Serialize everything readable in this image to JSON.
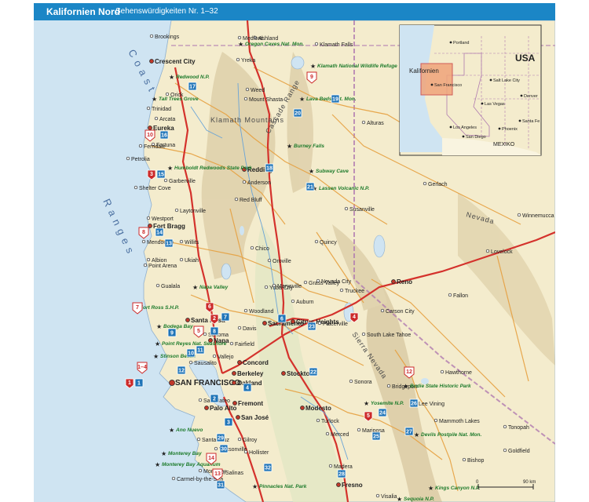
{
  "header": {
    "title": "Kalifornien Nord",
    "subtitle": "Sehenswürdigkeiten Nr. 1–32"
  },
  "colors": {
    "header_bar": "#1b86c6",
    "ocean": "#cfe4f2",
    "land": "#f4eccd",
    "highway": "#d4322c",
    "road": "#e6a040",
    "badge_blue": "#1f74b8",
    "pin_red": "#cc2a2a",
    "park_green": "#1c7a2a"
  },
  "cities": [
    {
      "id": "brookings",
      "label": "Brookings",
      "size": "small"
    },
    {
      "id": "crescent",
      "label": "Crescent City",
      "size": "medium"
    },
    {
      "id": "eureka",
      "label": "Eureka",
      "size": "medium"
    },
    {
      "id": "arcata",
      "label": "Arcata",
      "size": "small"
    },
    {
      "id": "fortuna",
      "label": "Fortuna",
      "size": "small"
    },
    {
      "id": "trinidad",
      "label": "Trinidad",
      "size": "small"
    },
    {
      "id": "orick",
      "label": "Orick",
      "size": "small"
    },
    {
      "id": "ferndale",
      "label": "Ferndale",
      "size": "small"
    },
    {
      "id": "petrolia",
      "label": "Petrolia",
      "size": "small"
    },
    {
      "id": "sheltercove",
      "label": "Shelter Cove",
      "size": "small"
    },
    {
      "id": "garberville",
      "label": "Garberville",
      "size": "small"
    },
    {
      "id": "westport",
      "label": "Westport",
      "size": "small"
    },
    {
      "id": "fortbragg",
      "label": "Fort Bragg",
      "size": "medium"
    },
    {
      "id": "mendocino",
      "label": "Mendocino",
      "size": "small"
    },
    {
      "id": "albion",
      "label": "Albion",
      "size": "small"
    },
    {
      "id": "pointarena",
      "label": "Point Arena",
      "size": "small"
    },
    {
      "id": "gualala",
      "label": "Gualala",
      "size": "small"
    },
    {
      "id": "ukiah",
      "label": "Ukiah",
      "size": "small"
    },
    {
      "id": "willits",
      "label": "Willits",
      "size": "small"
    },
    {
      "id": "laytonville",
      "label": "Laytonville",
      "size": "small"
    },
    {
      "id": "santarosa",
      "label": "Santa Rosa",
      "size": "medium"
    },
    {
      "id": "napa",
      "label": "Napa",
      "size": "medium"
    },
    {
      "id": "sonoma",
      "label": "Sonoma",
      "size": "small"
    },
    {
      "id": "fairfield",
      "label": "Fairfield",
      "size": "small"
    },
    {
      "id": "vallejo",
      "label": "Vallejo",
      "size": "small"
    },
    {
      "id": "sausalito",
      "label": "Sausalito",
      "size": "small"
    },
    {
      "id": "sf",
      "label": "SAN FRANCISCO",
      "size": "large"
    },
    {
      "id": "oakland",
      "label": "Oakland",
      "size": "medium"
    },
    {
      "id": "berkeley",
      "label": "Berkeley",
      "size": "medium"
    },
    {
      "id": "concord",
      "label": "Concord",
      "size": "medium"
    },
    {
      "id": "sanmateo",
      "label": "San Mateo",
      "size": "small"
    },
    {
      "id": "paloalto",
      "label": "Palo Alto",
      "size": "medium"
    },
    {
      "id": "fremont",
      "label": "Fremont",
      "size": "medium"
    },
    {
      "id": "sanjose",
      "label": "San José",
      "size": "medium"
    },
    {
      "id": "santacruz",
      "label": "Santa Cruz",
      "size": "small"
    },
    {
      "id": "monterey",
      "label": "Monterey",
      "size": "small"
    },
    {
      "id": "salinas",
      "label": "Salinas",
      "size": "small"
    },
    {
      "id": "carmel",
      "label": "Carmel-by-the-Sea",
      "size": "small"
    },
    {
      "id": "watsonville",
      "label": "Watsonville",
      "size": "small"
    },
    {
      "id": "gilroy",
      "label": "Gilroy",
      "size": "small"
    },
    {
      "id": "hollister",
      "label": "Hollister",
      "size": "small"
    },
    {
      "id": "stockton",
      "label": "Stockton",
      "size": "medium"
    },
    {
      "id": "modesto",
      "label": "Modesto",
      "size": "medium"
    },
    {
      "id": "merced",
      "label": "Merced",
      "size": "small"
    },
    {
      "id": "turlock",
      "label": "Turlock",
      "size": "small"
    },
    {
      "id": "fresno",
      "label": "Fresno",
      "size": "medium"
    },
    {
      "id": "madera",
      "label": "Madera",
      "size": "small"
    },
    {
      "id": "sacramento",
      "label": "Sacramento",
      "size": "medium"
    },
    {
      "id": "citrus",
      "label": "Citrus Heights",
      "size": "medium"
    },
    {
      "id": "davis",
      "label": "Davis",
      "size": "small"
    },
    {
      "id": "woodland",
      "label": "Woodland",
      "size": "small"
    },
    {
      "id": "yubacity",
      "label": "Yuba City",
      "size": "small"
    },
    {
      "id": "marysville",
      "label": "Marysville",
      "size": "small"
    },
    {
      "id": "oroville",
      "label": "Oroville",
      "size": "small"
    },
    {
      "id": "chico",
      "label": "Chico",
      "size": "small"
    },
    {
      "id": "redbluff",
      "label": "Red Bluff",
      "size": "small"
    },
    {
      "id": "redding",
      "label": "Redding",
      "size": "medium"
    },
    {
      "id": "anderson",
      "label": "Anderson",
      "size": "small"
    },
    {
      "id": "yreka",
      "label": "Yreka",
      "size": "small"
    },
    {
      "id": "weed",
      "label": "Weed",
      "size": "small"
    },
    {
      "id": "mtshasta",
      "label": "Mount Shasta",
      "size": "small"
    },
    {
      "id": "ashland",
      "label": "Ashland",
      "size": "small"
    },
    {
      "id": "medford",
      "label": "Medford",
      "size": "small"
    },
    {
      "id": "klamathfalls",
      "label": "Klamath Falls",
      "size": "small"
    },
    {
      "id": "alturas",
      "label": "Alturas",
      "size": "small"
    },
    {
      "id": "susanville",
      "label": "Susanville",
      "size": "small"
    },
    {
      "id": "quincy",
      "label": "Quincy",
      "size": "small"
    },
    {
      "id": "grassvalley",
      "label": "Grass Valley",
      "size": "small"
    },
    {
      "id": "nevadacity",
      "label": "Nevada City",
      "size": "small"
    },
    {
      "id": "truckee",
      "label": "Truckee",
      "size": "small"
    },
    {
      "id": "reno",
      "label": "Reno",
      "size": "medium"
    },
    {
      "id": "carsoncity",
      "label": "Carson City",
      "size": "small"
    },
    {
      "id": "southlaketahoe",
      "label": "South Lake Tahoe",
      "size": "small"
    },
    {
      "id": "placerville",
      "label": "Placerville",
      "size": "small"
    },
    {
      "id": "auburn",
      "label": "Auburn",
      "size": "small"
    },
    {
      "id": "sonora",
      "label": "Sonora",
      "size": "small"
    },
    {
      "id": "mariposa",
      "label": "Mariposa",
      "size": "small"
    },
    {
      "id": "bridgeport",
      "label": "Bridgeport",
      "size": "small"
    },
    {
      "id": "leevining",
      "label": "Lee Vining",
      "size": "small"
    },
    {
      "id": "mammoth",
      "label": "Mammoth Lakes",
      "size": "small"
    },
    {
      "id": "bishop",
      "label": "Bishop",
      "size": "small"
    },
    {
      "id": "hawthorne",
      "label": "Hawthorne",
      "size": "small"
    },
    {
      "id": "fallon",
      "label": "Fallon",
      "size": "small"
    },
    {
      "id": "lovelock",
      "label": "Lovelock",
      "size": "small"
    },
    {
      "id": "winnemucca",
      "label": "Winnemucca",
      "size": "small"
    },
    {
      "id": "gerlach",
      "label": "Gerlach",
      "size": "small"
    },
    {
      "id": "tonopah",
      "label": "Tonopah",
      "size": "small"
    },
    {
      "id": "goldfield",
      "label": "Goldfield",
      "size": "small"
    },
    {
      "id": "visalia",
      "label": "Visalia",
      "size": "small"
    }
  ],
  "parks": [
    {
      "id": "redwood",
      "label": "Redwood N.P."
    },
    {
      "id": "talltrees",
      "label": "Tall Trees Grove"
    },
    {
      "id": "humboldt",
      "label": "Humboldt Redwoods State Park"
    },
    {
      "id": "lassen",
      "label": "Lassen Volcanic N.P."
    },
    {
      "id": "lavabeds",
      "label": "Lava Beds Nat. Mon."
    },
    {
      "id": "oregoncaves",
      "label": "Oregon Caves Nat. Mon."
    },
    {
      "id": "klamathnwr",
      "label": "Klamath National Wildlife Refuge"
    },
    {
      "id": "burneyfalls",
      "label": "Burney Falls"
    },
    {
      "id": "subwaycave",
      "label": "Subway Cave"
    },
    {
      "id": "fortross",
      "label": "Fort Ross S.H.P."
    },
    {
      "id": "pointreyes",
      "label": "Point Reyes Nat. Seashore"
    },
    {
      "id": "yosemite",
      "label": "Yosemite N.P."
    },
    {
      "id": "bodie",
      "label": "Bodie State Historic Park"
    },
    {
      "id": "devils",
      "label": "Devils Postpile Nat. Mon."
    },
    {
      "id": "kingscanyon",
      "label": "Kings Canyon N.P."
    },
    {
      "id": "sequoia",
      "label": "Sequoia N.P."
    },
    {
      "id": "pinnacles",
      "label": "Pinnacles Nat. Park"
    },
    {
      "id": "anonuevo",
      "label": "Ano Nuevo"
    },
    {
      "id": "montereybay",
      "label": "Monterey Bay"
    },
    {
      "id": "montereyaquarium",
      "label": "Monterey Bay Aquarium"
    },
    {
      "id": "stinson",
      "label": "Stinson Beach"
    },
    {
      "id": "bodegabay",
      "label": "Bodega Bay"
    },
    {
      "id": "napavalley",
      "label": "Napa Valley"
    }
  ],
  "ranges": [
    {
      "id": "coastranges_a",
      "label": "Coast"
    },
    {
      "id": "coastranges_b",
      "label": "Ranges"
    },
    {
      "id": "cascade",
      "label": "Cascade Range"
    },
    {
      "id": "klamathmtns",
      "label": "Klamath Mountains"
    },
    {
      "id": "sierra",
      "label": "Sierra Nevada"
    },
    {
      "id": "nevada",
      "label": "Nevada"
    }
  ],
  "sights_blue": [
    "1",
    "2",
    "3",
    "4",
    "6",
    "7",
    "8",
    "9",
    "10",
    "11",
    "12",
    "13",
    "14",
    "15",
    "16",
    "17",
    "18",
    "19",
    "20",
    "21",
    "22",
    "23",
    "24",
    "25",
    "26",
    "27",
    "28",
    "29",
    "30",
    "31",
    "32"
  ],
  "sights_red": [
    "1",
    "2",
    "3",
    "4",
    "5",
    "6"
  ],
  "sights_outline": [
    "1–4",
    "5",
    "7",
    "8",
    "9",
    "10",
    "12",
    "13",
    "14"
  ],
  "inset": {
    "country_usa": "USA",
    "country_mexico": "MEXIKO",
    "state_label": "Kalifornien",
    "cities": [
      "Portland",
      "Salt Lake City",
      "Denver",
      "San Francisco",
      "Las Vegas",
      "Los Angeles",
      "San Diego",
      "Phoenix",
      "Santa Fe"
    ]
  },
  "scale": {
    "zero": "0",
    "end": "90 km"
  }
}
